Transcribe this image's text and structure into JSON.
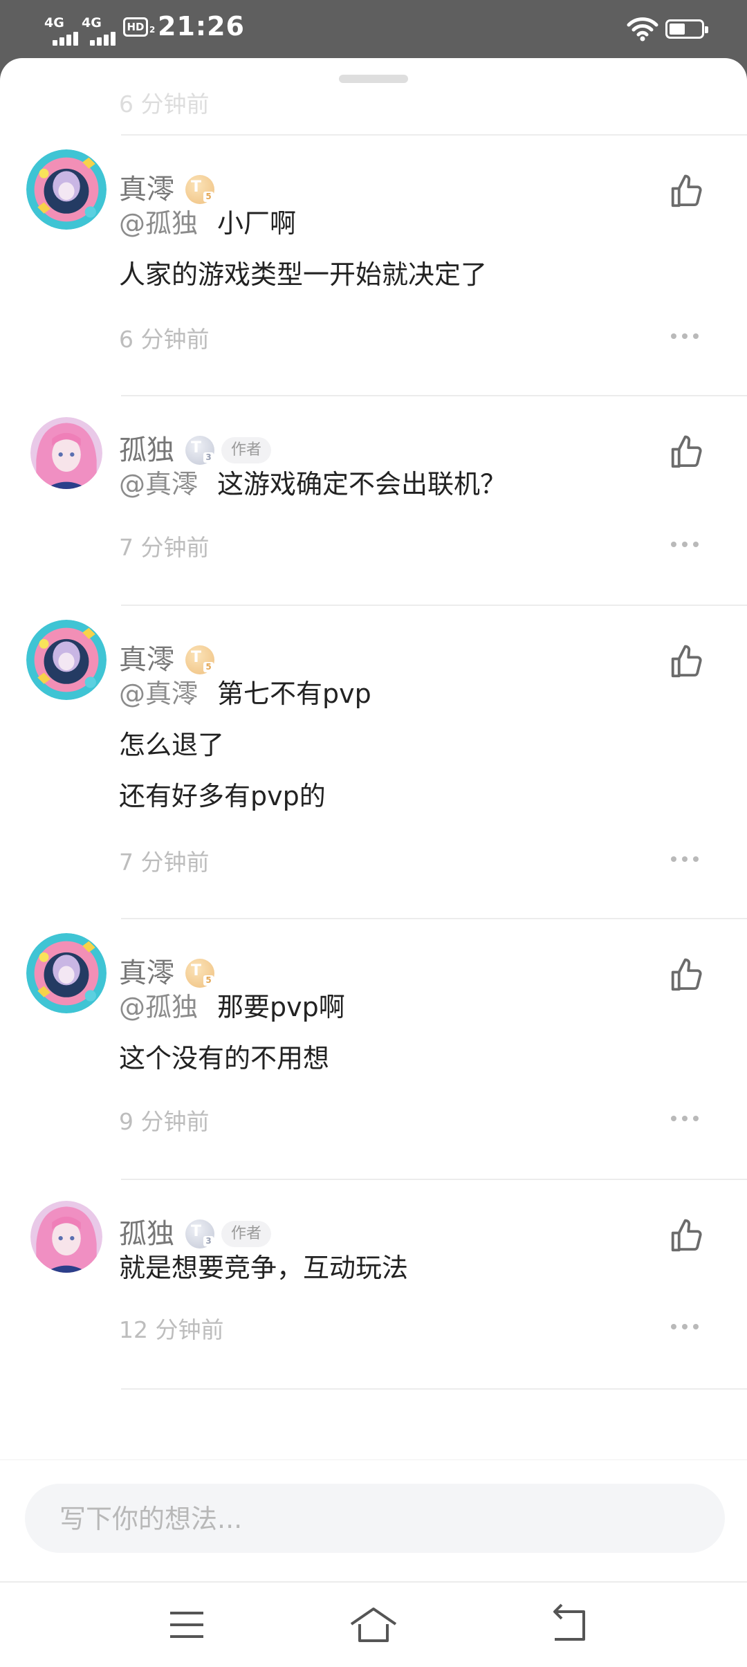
{
  "status_bar": {
    "signal1": "4G",
    "signal2": "4G",
    "hd": "HD",
    "hd_sub": "2",
    "time": "21:26",
    "icons": [
      "signal-icon",
      "signal-icon",
      "hd-icon",
      "wifi-icon",
      "battery-icon"
    ]
  },
  "previous_comment_time": "6 分钟前",
  "comments": [
    {
      "user": "真澪",
      "level": "5",
      "level_icon": "T",
      "is_author": false,
      "lines": [
        {
          "mention": "@孤独",
          "text": "小厂啊"
        },
        {
          "mention": "",
          "text": "人家的游戏类型一开始就决定了"
        }
      ],
      "time": "6 分钟前"
    },
    {
      "user": "孤独",
      "level": "3",
      "level_icon": "T",
      "is_author": true,
      "author_label": "作者",
      "lines": [
        {
          "mention": "@真澪",
          "text": "这游戏确定不会出联机？"
        }
      ],
      "time": "7 分钟前"
    },
    {
      "user": "真澪",
      "level": "5",
      "level_icon": "T",
      "is_author": false,
      "lines": [
        {
          "mention": "@真澪",
          "text": "第七不有pvp"
        },
        {
          "mention": "",
          "text": "怎么退了"
        },
        {
          "mention": "",
          "text": "还有好多有pvp的"
        }
      ],
      "time": "7 分钟前"
    },
    {
      "user": "真澪",
      "level": "5",
      "level_icon": "T",
      "is_author": false,
      "lines": [
        {
          "mention": "@孤独",
          "text": "那要pvp啊"
        },
        {
          "mention": "",
          "text": "这个没有的不用想"
        }
      ],
      "time": "9 分钟前"
    },
    {
      "user": "孤独",
      "level": "3",
      "level_icon": "T",
      "is_author": true,
      "author_label": "作者",
      "lines": [
        {
          "mention": "",
          "text": "就是想要竞争，互动玩法"
        }
      ],
      "time": "12 分钟前"
    }
  ],
  "comment_input": {
    "placeholder": "写下你的想法..."
  },
  "nav_bar": {
    "buttons": [
      "menu-icon",
      "home-icon",
      "back-icon"
    ]
  },
  "colors": {
    "status_bar_bg": "#5f5f5f",
    "username": "#777777",
    "content_text": "#222222",
    "mention": "#8c8c8c",
    "timestamp": "#bdbdbd",
    "input_bg": "#f4f5f7",
    "badge_gold": "#efc07f",
    "badge_silver": "#c3c8d6"
  }
}
